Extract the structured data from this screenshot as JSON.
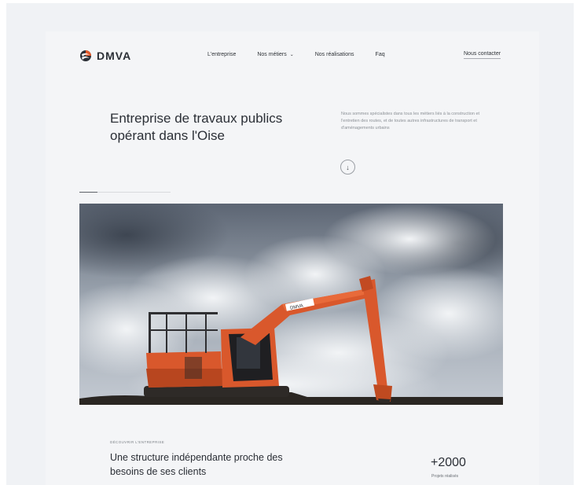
{
  "brand": {
    "name": "DMVA",
    "accent": "#e25a2b"
  },
  "nav": {
    "items": [
      {
        "label": "L'entreprise"
      },
      {
        "label": "Nos métiers",
        "has_dropdown": true,
        "icon": "chevron-down-icon"
      },
      {
        "label": "Nos réalisations"
      },
      {
        "label": "Faq"
      }
    ],
    "contact_label": "Nous contacter"
  },
  "hero": {
    "title": "Entreprise de travaux publics opérant dans l'Oise",
    "description": "Nous sommes spécialistes dans tous les métiers liés à la construction et l'entretien des routes, et de toutes autres infrastructures de transport et d'aménagements urbains",
    "scroll_icon": "arrow-down-icon",
    "slider_progress": 0.2,
    "image_badge": "DMVA"
  },
  "about": {
    "eyebrow": "Découvrir l'entreprise",
    "title": "Une structure indépendante proche des besoins de ses clients",
    "stat_value": "+2000",
    "stat_label": "Projets réalisés"
  },
  "colors": {
    "background": "#f0f2f5",
    "text": "#2b2f36",
    "excavator": "#d9582c"
  }
}
